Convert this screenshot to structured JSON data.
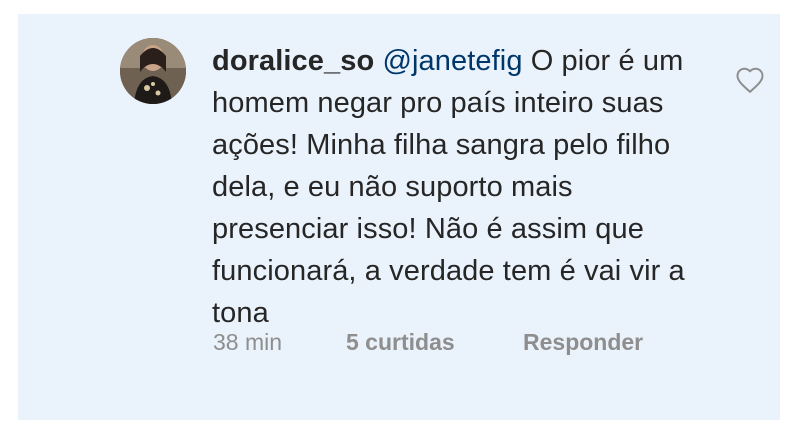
{
  "comment": {
    "username": "doralice_so",
    "mention": "@janetefig",
    "text": "O pior é um homem negar pro país inteiro suas ações! Minha filha sangra pelo filho dela, e eu não suporto mais presenciar isso! Não é assim que funcionará, a verdade tem é vai vir a tona",
    "time": "38 min",
    "likes": "5 curtidas",
    "reply_label": "Responder"
  },
  "icons": {
    "like": "heart-outline-icon"
  },
  "colors": {
    "background": "#eaf2fb",
    "text": "#262626",
    "mention": "#00376b",
    "meta": "#8e8e8e"
  }
}
